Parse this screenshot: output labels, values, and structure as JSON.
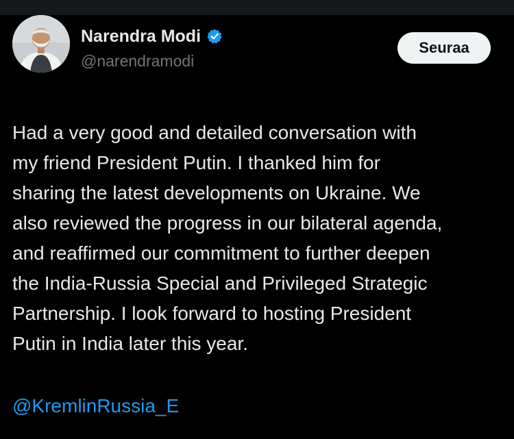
{
  "author": {
    "name": "Narendra Modi",
    "handle": "@narendramodi",
    "verified": true,
    "verified_color": "#1d9bf0"
  },
  "actions": {
    "follow_label": "Seuraa"
  },
  "post": {
    "lines": [
      "Had a very good and detailed conversation with",
      "my friend President Putin. I thanked him for",
      "sharing the latest developments on Ukraine. We",
      "also reviewed the progress in our bilateral agenda,",
      "and reaffirmed our commitment to further deepen",
      "the India-Russia Special and Privileged Strategic",
      "Partnership. I look forward to hosting President",
      "Putin in India later this year."
    ],
    "mention": "@KremlinRussia_E"
  },
  "colors": {
    "background": "#000000",
    "text": "#e7e9ea",
    "secondary_text": "#71767b",
    "link": "#1d9bf0",
    "button_bg": "#eff3f4",
    "button_text": "#0f1419"
  },
  "icons": {
    "verified": "verified-badge-icon",
    "avatar": "profile-photo"
  }
}
